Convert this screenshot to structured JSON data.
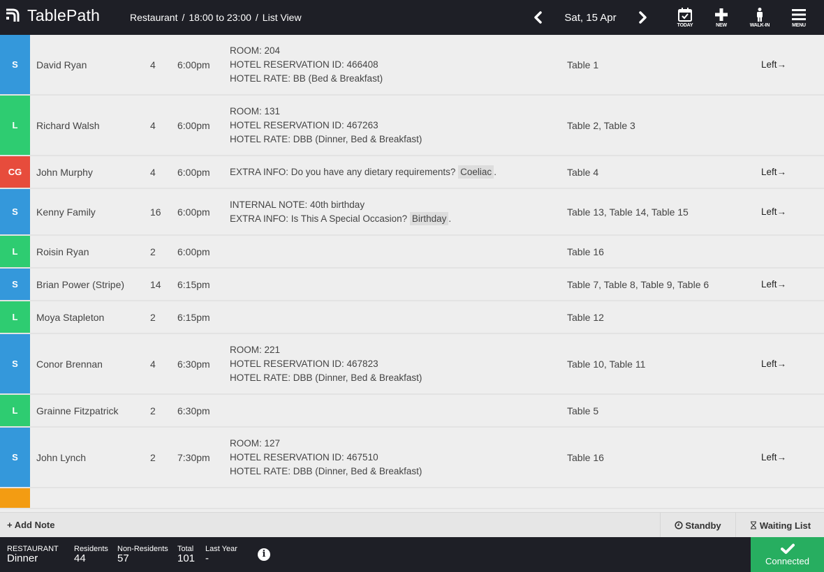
{
  "app": {
    "name": "TablePath",
    "breadcrumb": [
      "Restaurant",
      "18:00 to 23:00",
      "List View"
    ],
    "breadcrumb_separator": "/"
  },
  "date_nav": {
    "date": "Sat, 15 Apr",
    "prev_icon": "chevron-left-icon",
    "next_icon": "chevron-right-icon"
  },
  "toolbar": [
    {
      "label": "TODAY",
      "icon": "calendar-check-icon"
    },
    {
      "label": "NEW",
      "icon": "plus-icon"
    },
    {
      "label": "WALK-IN",
      "icon": "person-icon"
    },
    {
      "label": "MENU",
      "icon": "hamburger-icon"
    }
  ],
  "colors": {
    "S": "#3498db",
    "L": "#2ecc71",
    "CG": "#e74c3c",
    "pending": "#f39c12",
    "connected": "#27ae60",
    "bar": "#1e1f26"
  },
  "reservations": [
    {
      "badge": "S",
      "name": "David Ryan",
      "covers": "4",
      "time": "6:00pm",
      "notes": [
        [
          "ROOM: 204"
        ],
        [
          "HOTEL RESERVATION ID: 466408"
        ],
        [
          "HOTEL RATE: BB (Bed & Breakfast)"
        ]
      ],
      "tables": "Table 1",
      "status": "Left→"
    },
    {
      "badge": "L",
      "name": "Richard Walsh",
      "covers": "4",
      "time": "6:00pm",
      "notes": [
        [
          "ROOM: 131"
        ],
        [
          "HOTEL RESERVATION ID: 467263"
        ],
        [
          "HOTEL RATE: DBB (Dinner, Bed & Breakfast)"
        ]
      ],
      "tables": "Table 2, Table 3",
      "status": ""
    },
    {
      "badge": "CG",
      "name": "John Murphy",
      "covers": "4",
      "time": "6:00pm",
      "notes": [
        [
          "EXTRA INFO: Do you have any dietary requirements? ",
          "Coeliac",
          "."
        ]
      ],
      "tables": "Table 4",
      "status": "Left→"
    },
    {
      "badge": "S",
      "name": "Kenny Family",
      "covers": "16",
      "time": "6:00pm",
      "notes": [
        [
          "INTERNAL NOTE: 40th birthday"
        ],
        [
          "EXTRA INFO: Is This A Special Occasion? ",
          "Birthday",
          "."
        ]
      ],
      "tables": "Table 13, Table 14, Table 15",
      "status": "Left→"
    },
    {
      "badge": "L",
      "name": "Roisin Ryan",
      "covers": "2",
      "time": "6:00pm",
      "notes": [],
      "tables": "Table 16",
      "status": ""
    },
    {
      "badge": "S",
      "name": "Brian Power (Stripe)",
      "covers": "14",
      "time": "6:15pm",
      "notes": [],
      "tables": "Table 7, Table 8, Table 9, Table 6",
      "status": "Left→"
    },
    {
      "badge": "L",
      "name": "Moya Stapleton",
      "covers": "2",
      "time": "6:15pm",
      "notes": [],
      "tables": "Table 12",
      "status": ""
    },
    {
      "badge": "S",
      "name": "Conor Brennan",
      "covers": "4",
      "time": "6:30pm",
      "notes": [
        [
          "ROOM: 221"
        ],
        [
          "HOTEL RESERVATION ID: 467823"
        ],
        [
          "HOTEL RATE: DBB (Dinner, Bed & Breakfast)"
        ]
      ],
      "tables": "Table 10, Table 11",
      "status": "Left→"
    },
    {
      "badge": "L",
      "name": "Grainne Fitzpatrick",
      "covers": "2",
      "time": "6:30pm",
      "notes": [],
      "tables": "Table 5",
      "status": ""
    },
    {
      "badge": "S",
      "name": "John Lynch",
      "covers": "2",
      "time": "7:30pm",
      "notes": [
        [
          "ROOM: 127"
        ],
        [
          "HOTEL RESERVATION ID: 467510"
        ],
        [
          "HOTEL RATE: DBB (Dinner, Bed & Breakfast)"
        ]
      ],
      "tables": "Table 16",
      "status": "Left→"
    },
    {
      "badge": "pending",
      "badge_text": "",
      "name": "",
      "covers": "",
      "time": "",
      "notes": [],
      "tables": "",
      "status": "",
      "partial": true
    }
  ],
  "actions": {
    "add_note": "+ Add Note",
    "standby": "Standby",
    "waiting_list": "Waiting List"
  },
  "footer": {
    "service_label": "RESTAURANT",
    "service_value": "Dinner",
    "stats": [
      {
        "label": "Residents",
        "value": "44"
      },
      {
        "label": "Non-Residents",
        "value": "57"
      },
      {
        "label": "Total",
        "value": "101"
      },
      {
        "label": "Last Year",
        "value": "-"
      }
    ],
    "info_glyph": "i",
    "connection": "Connected"
  }
}
